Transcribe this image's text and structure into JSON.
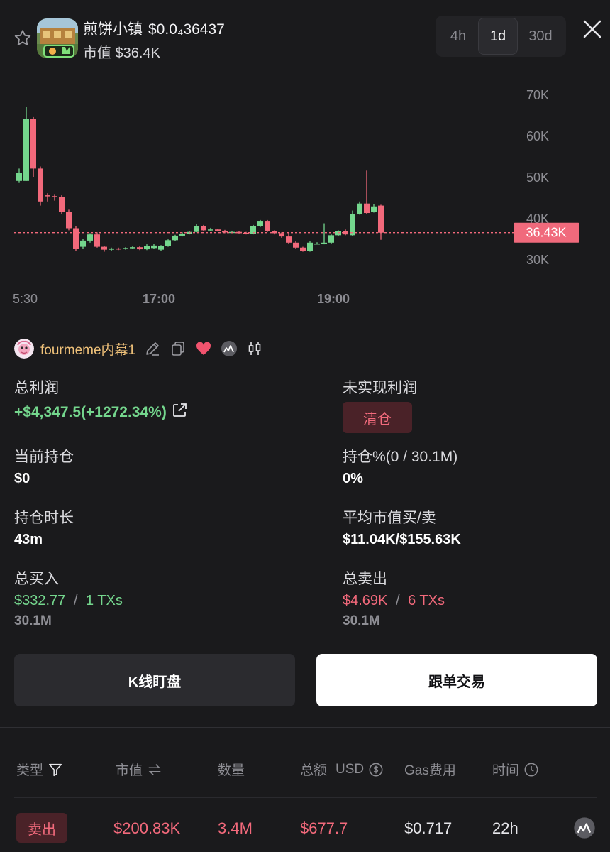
{
  "header": {
    "token_name": "煎饼小镇",
    "price": "$0.0₄36437",
    "mcap_label": "市值 $36.4K",
    "timeframes": [
      "4h",
      "1d",
      "30d"
    ],
    "active_timeframe": "1d"
  },
  "chart": {
    "y_ticks": [
      "70K",
      "60K",
      "50K",
      "40K",
      "30K"
    ],
    "x_ticks": [
      "5:30",
      "17:00",
      "19:00"
    ],
    "current_label": "36.43K",
    "colors": {
      "up": "#74d68d",
      "down": "#f2697b",
      "current_line": "#f2697b"
    }
  },
  "chart_data": {
    "type": "candlestick",
    "x_tick_labels": [
      "5:30",
      "17:00",
      "19:00"
    ],
    "y_tick_labels": [
      "70K",
      "60K",
      "50K",
      "40K",
      "30K"
    ],
    "ylim": [
      26000,
      72000
    ],
    "current_value": 36430,
    "candles": [
      {
        "o": 49000,
        "c": 51000,
        "h": 52000,
        "l": 48500
      },
      {
        "o": 49000,
        "c": 64000,
        "h": 67000,
        "l": 49000
      },
      {
        "o": 64000,
        "c": 52000,
        "h": 64500,
        "l": 50000
      },
      {
        "o": 52000,
        "c": 44000,
        "h": 52500,
        "l": 43000
      },
      {
        "o": 45500,
        "c": 45300,
        "h": 46000,
        "l": 44000
      },
      {
        "o": 45300,
        "c": 45000,
        "h": 45800,
        "l": 44200
      },
      {
        "o": 45000,
        "c": 41500,
        "h": 45500,
        "l": 41000
      },
      {
        "o": 41500,
        "c": 37500,
        "h": 42000,
        "l": 37000
      },
      {
        "o": 37500,
        "c": 32500,
        "h": 38000,
        "l": 32000
      },
      {
        "o": 33000,
        "c": 34500,
        "h": 35000,
        "l": 32500
      },
      {
        "o": 34500,
        "c": 36000,
        "h": 36300,
        "l": 34000
      },
      {
        "o": 36000,
        "c": 33000,
        "h": 36500,
        "l": 32800
      },
      {
        "o": 33000,
        "c": 32300,
        "h": 33200,
        "l": 31800
      },
      {
        "o": 32300,
        "c": 32600,
        "h": 32800,
        "l": 32000
      },
      {
        "o": 32600,
        "c": 32500,
        "h": 32800,
        "l": 32200
      },
      {
        "o": 32500,
        "c": 32700,
        "h": 32900,
        "l": 32300
      },
      {
        "o": 32700,
        "c": 32900,
        "h": 33100,
        "l": 32500
      },
      {
        "o": 32900,
        "c": 32400,
        "h": 33100,
        "l": 32200
      },
      {
        "o": 32400,
        "c": 33200,
        "h": 33600,
        "l": 32200
      },
      {
        "o": 32700,
        "c": 33300,
        "h": 33700,
        "l": 32500
      },
      {
        "o": 32300,
        "c": 33200,
        "h": 33400,
        "l": 31900
      },
      {
        "o": 33200,
        "c": 34600,
        "h": 34800,
        "l": 33000
      },
      {
        "o": 34600,
        "c": 35700,
        "h": 35900,
        "l": 34400
      },
      {
        "o": 35700,
        "c": 36200,
        "h": 36500,
        "l": 35500
      },
      {
        "o": 36200,
        "c": 36600,
        "h": 36900,
        "l": 36000
      },
      {
        "o": 36600,
        "c": 38000,
        "h": 38500,
        "l": 36500
      },
      {
        "o": 38000,
        "c": 37000,
        "h": 38300,
        "l": 36800
      },
      {
        "o": 37000,
        "c": 37200,
        "h": 37600,
        "l": 36800
      },
      {
        "o": 37200,
        "c": 36900,
        "h": 37400,
        "l": 36700
      },
      {
        "o": 36900,
        "c": 36500,
        "h": 37100,
        "l": 36300
      },
      {
        "o": 36500,
        "c": 36600,
        "h": 36900,
        "l": 36300
      },
      {
        "o": 36600,
        "c": 36400,
        "h": 36800,
        "l": 36200
      },
      {
        "o": 36400,
        "c": 36200,
        "h": 36600,
        "l": 36000
      },
      {
        "o": 36200,
        "c": 38000,
        "h": 38300,
        "l": 36000
      },
      {
        "o": 38000,
        "c": 39300,
        "h": 39500,
        "l": 37800
      },
      {
        "o": 39300,
        "c": 36800,
        "h": 39500,
        "l": 36600
      },
      {
        "o": 36800,
        "c": 36300,
        "h": 37000,
        "l": 36000
      },
      {
        "o": 36300,
        "c": 35500,
        "h": 36500,
        "l": 35200
      },
      {
        "o": 35500,
        "c": 34000,
        "h": 36400,
        "l": 33800
      },
      {
        "o": 34000,
        "c": 32800,
        "h": 34300,
        "l": 32500
      },
      {
        "o": 32800,
        "c": 32000,
        "h": 33000,
        "l": 31800
      },
      {
        "o": 32000,
        "c": 34000,
        "h": 34300,
        "l": 31800
      },
      {
        "o": 33800,
        "c": 33800,
        "h": 34100,
        "l": 33600
      },
      {
        "o": 33800,
        "c": 34000,
        "h": 38700,
        "l": 33600
      },
      {
        "o": 34000,
        "c": 35800,
        "h": 36000,
        "l": 33800
      },
      {
        "o": 35800,
        "c": 36800,
        "h": 37000,
        "l": 35600
      },
      {
        "o": 36800,
        "c": 36000,
        "h": 37200,
        "l": 35800
      },
      {
        "o": 35800,
        "c": 41000,
        "h": 41800,
        "l": 35600
      },
      {
        "o": 41000,
        "c": 43500,
        "h": 44000,
        "l": 40800
      },
      {
        "o": 43500,
        "c": 41200,
        "h": 51500,
        "l": 41000
      },
      {
        "o": 41500,
        "c": 42800,
        "h": 43300,
        "l": 41300
      },
      {
        "o": 43000,
        "c": 36430,
        "h": 43200,
        "l": 34700
      }
    ]
  },
  "trader": {
    "name": "fourmeme内幕1",
    "icons": [
      "pencil-icon",
      "copy-icon",
      "heart-icon",
      "chart-logo-icon",
      "candles-icon"
    ]
  },
  "stats": {
    "total_profit_label": "总利润",
    "total_profit_value": "+$4,347.5(+1272.34%)",
    "unrealized_label": "未实现利润",
    "clear_label": "清仓",
    "holding_label": "当前持仓",
    "holding_value": "$0",
    "holding_pct_label": "持仓%(0 / 30.1M)",
    "holding_pct_value": "0%",
    "hold_time_label": "持仓时长",
    "hold_time_value": "43m",
    "avg_mcap_label": "平均市值买/卖",
    "avg_mcap_value": "$11.04K/$155.63K",
    "total_buy_label": "总买入",
    "total_buy_amount": "$332.77",
    "total_buy_txs": "1 TXs",
    "total_buy_qty": "30.1M",
    "total_sell_label": "总卖出",
    "total_sell_amount": "$4.69K",
    "total_sell_txs": "6 TXs",
    "total_sell_qty": "30.1M",
    "separator": "/"
  },
  "buttons": {
    "kline": "K线盯盘",
    "copy_trade": "跟单交易"
  },
  "table": {
    "headers": {
      "type": "类型",
      "mcap": "市值",
      "qty": "数量",
      "total": "总额",
      "usd": "USD",
      "gas": "Gas费用",
      "time": "时间"
    },
    "rows": [
      {
        "type": "卖出",
        "mcap": "$200.83K",
        "qty": "3.4M",
        "total": "$677.7",
        "gas": "$0.717",
        "time": "22h"
      }
    ]
  }
}
